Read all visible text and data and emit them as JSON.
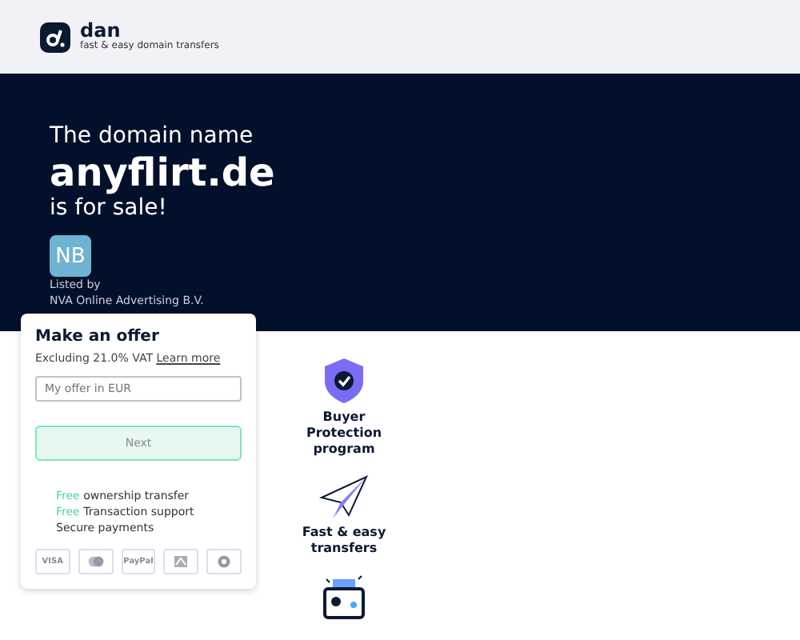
{
  "header": {
    "brand": "dan",
    "tagline": "fast & easy domain transfers"
  },
  "hero": {
    "intro": "The domain name",
    "domain": "anyflirt.de",
    "suffix": "is for sale!"
  },
  "seller": {
    "initials": "NB",
    "listed_by": "Listed by",
    "name": "NVA Online Advertising B.V."
  },
  "offer_card": {
    "title": "Make an offer",
    "vat_note": "Excluding 21.0% VAT",
    "learn_more": "Learn more",
    "offer_field": {
      "placeholder": "My offer in EUR"
    },
    "next_button": "Next",
    "benefits": [
      {
        "highlight": "Free",
        "text": "ownership transfer"
      },
      {
        "highlight": "Free",
        "text": "Transaction support"
      },
      {
        "text": "Secure payments"
      }
    ],
    "payment_methods": [
      {
        "kind": "visa",
        "label": "VISA"
      },
      {
        "kind": "mastercard"
      },
      {
        "kind": "paypal",
        "label": "PayPal"
      },
      {
        "kind": "bank"
      },
      {
        "kind": "bitcoin"
      }
    ]
  },
  "features": [
    {
      "kind": "shield",
      "title": "Buyer Protection program"
    },
    {
      "kind": "plane",
      "title": "Fast & easy transfers"
    },
    {
      "kind": "wallet"
    }
  ]
}
